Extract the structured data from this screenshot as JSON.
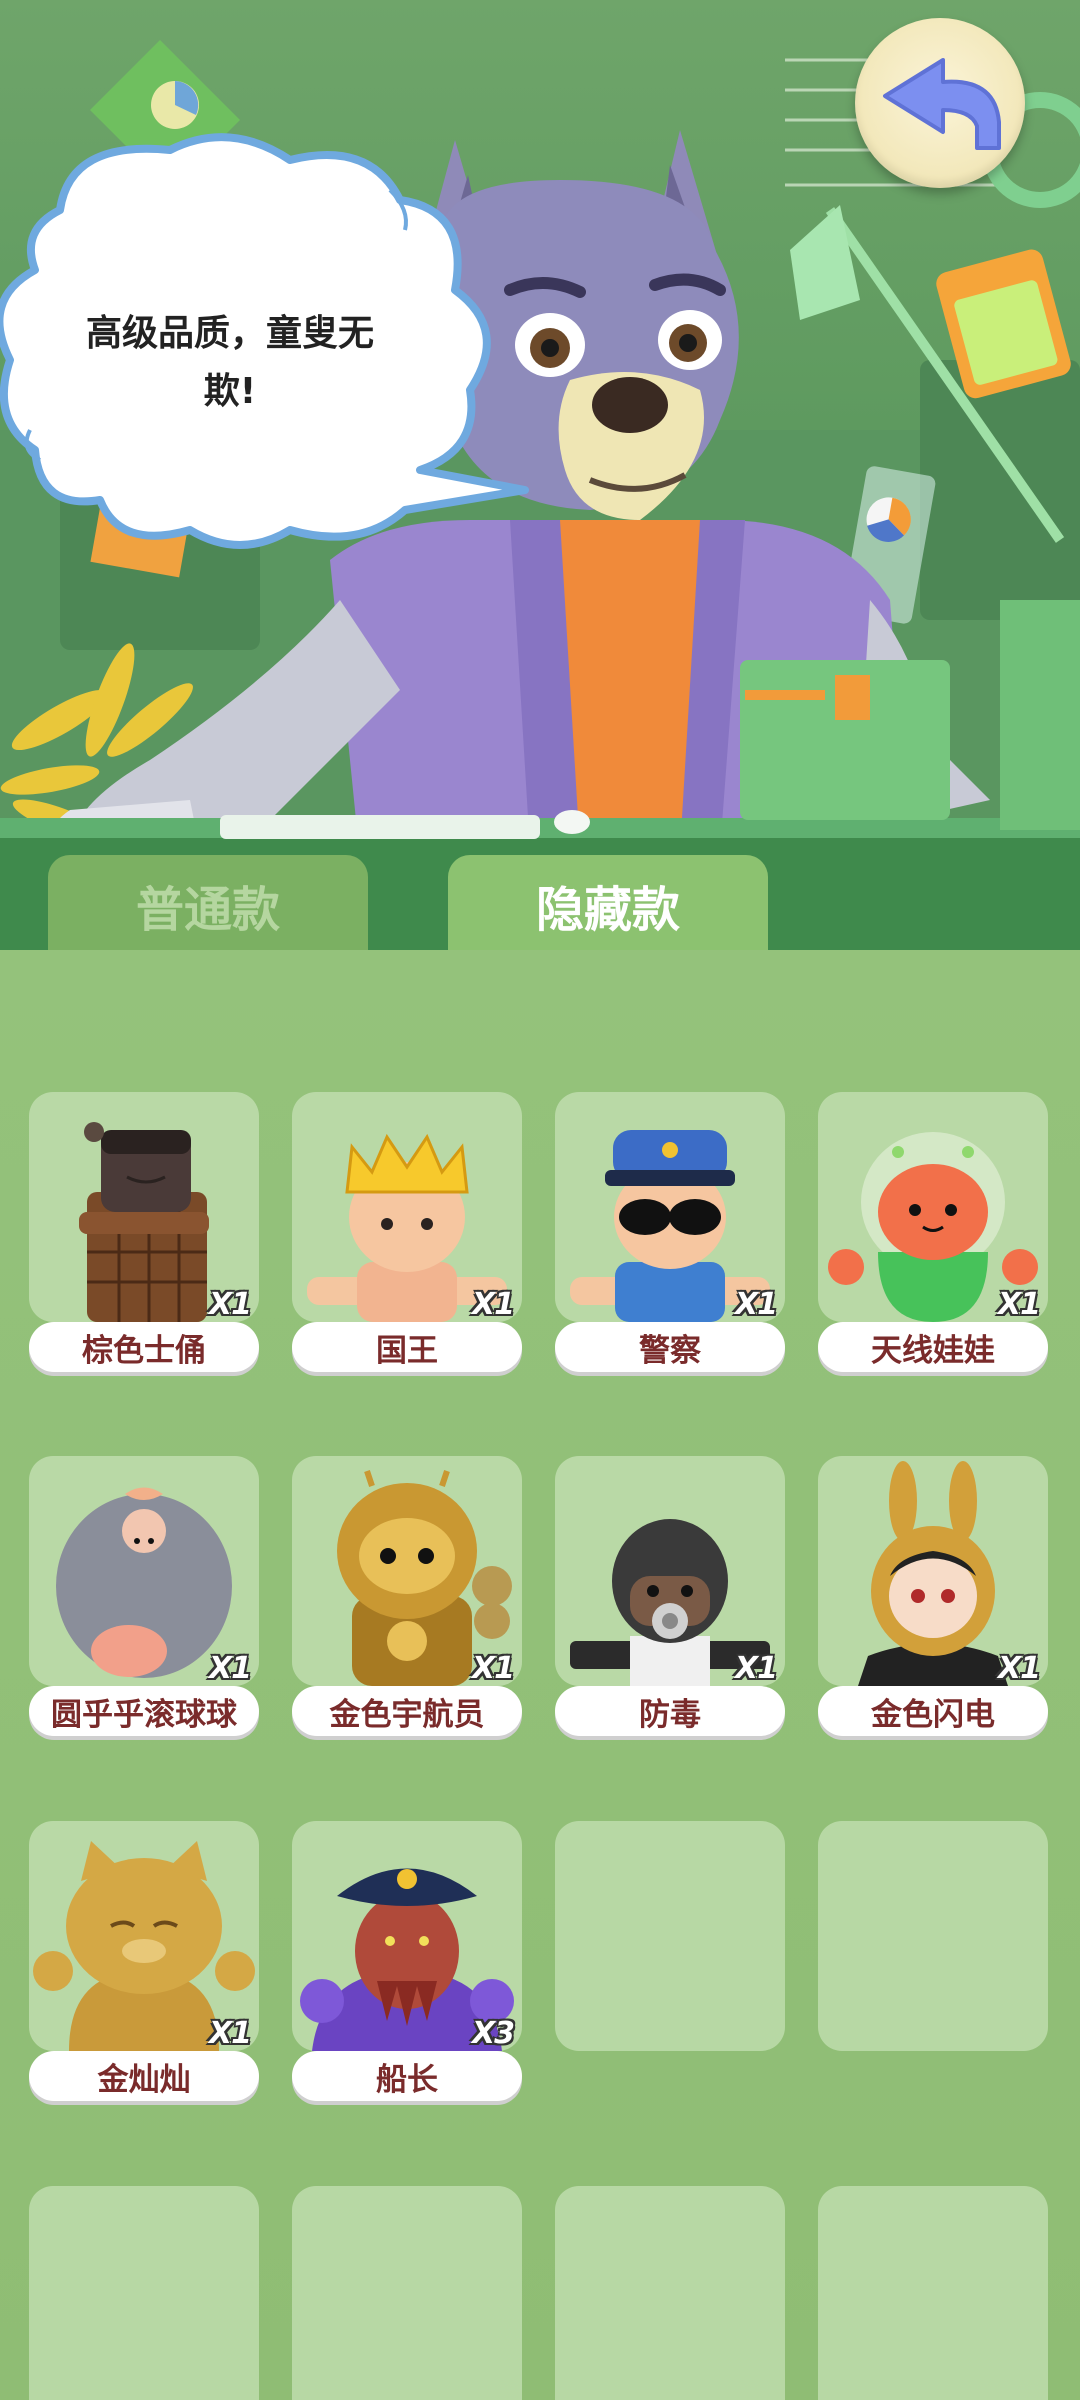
{
  "hero": {
    "bubble_text": "高级品质，童叟无欺!",
    "bubble_line1": "高级品质，童叟无",
    "bubble_line2": "欺!"
  },
  "back_button": {
    "icon": "back-arrow-icon",
    "color": "#7c8ff0"
  },
  "tabs": [
    {
      "label": "普通款",
      "active": false
    },
    {
      "label": "隐藏款",
      "active": true
    }
  ],
  "colors": {
    "panel_bg": "#8fbc73",
    "cell_bg": "#b9d9a6",
    "name_text": "#7a2b2b",
    "tab_active": "#8cc270",
    "tab_inactive": "#7bb062"
  },
  "collection": [
    {
      "name": "棕色士俑",
      "count": "X1",
      "icon": "terracotta-warrior-figure"
    },
    {
      "name": "国王",
      "count": "X1",
      "icon": "king-figure"
    },
    {
      "name": "警察",
      "count": "X1",
      "icon": "police-figure"
    },
    {
      "name": "天线娃娃",
      "count": "X1",
      "icon": "antenna-doll-figure"
    },
    {
      "name": "圆乎乎滚球球",
      "count": "X1",
      "icon": "round-ball-figure"
    },
    {
      "name": "金色宇航员",
      "count": "X1",
      "icon": "golden-astronaut-figure"
    },
    {
      "name": "防毒",
      "count": "X1",
      "icon": "gas-mask-figure"
    },
    {
      "name": "金色闪电",
      "count": "X1",
      "icon": "golden-lightning-figure"
    },
    {
      "name": "金灿灿",
      "count": "X1",
      "icon": "golden-cat-figure"
    },
    {
      "name": "船长",
      "count": "X3",
      "icon": "captain-figure"
    }
  ]
}
